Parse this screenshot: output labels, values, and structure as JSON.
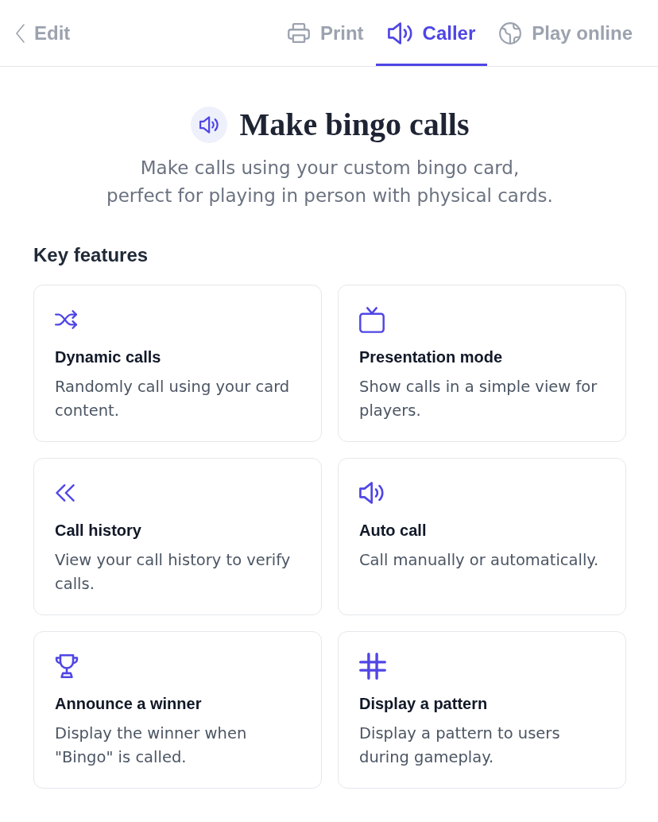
{
  "header": {
    "back": {
      "label": "Edit"
    },
    "tabs": [
      {
        "label": "Print",
        "selected": false
      },
      {
        "label": "Caller",
        "selected": true
      },
      {
        "label": "Play online",
        "selected": false
      }
    ]
  },
  "hero": {
    "title": "Make bingo calls",
    "subtitle": "Make calls using your custom bingo card,\nperfect for playing in person with physical cards."
  },
  "features": {
    "heading": "Key features",
    "items": [
      {
        "title": "Dynamic calls",
        "description": "Randomly call using your card content."
      },
      {
        "title": "Presentation mode",
        "description": "Show calls in a simple view for players."
      },
      {
        "title": "Call history",
        "description": "View your call history to verify calls."
      },
      {
        "title": "Auto call",
        "description": "Call manually or automatically."
      },
      {
        "title": "Announce a winner",
        "description": "Display the winner when \"Bingo\" is called."
      },
      {
        "title": "Display a pattern",
        "description": "Display a pattern to users during gameplay."
      }
    ]
  }
}
